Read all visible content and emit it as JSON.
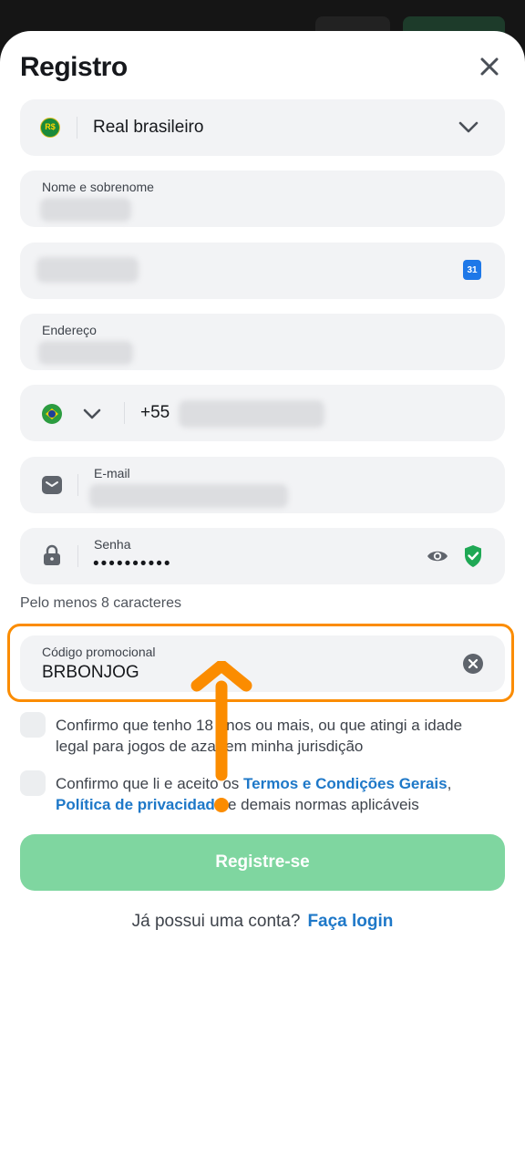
{
  "title": "Registro",
  "currency": {
    "symbol": "R$",
    "label": "Real brasileiro"
  },
  "name_field": {
    "label": "Nome e sobrenome"
  },
  "birthdate_field": {
    "calendar_day": "31"
  },
  "address_field": {
    "label": "Endereço"
  },
  "phone_field": {
    "country_code": "+55"
  },
  "email_field": {
    "label": "E-mail"
  },
  "password_field": {
    "label": "Senha",
    "value": "••••••••••"
  },
  "password_hint": "Pelo menos 8 caracteres",
  "promo_field": {
    "label": "Código promocional",
    "value": "BRBONJOG"
  },
  "age_checkbox": {
    "text": "Confirmo que tenho 18 anos ou mais, ou que atingi a idade legal para jogos de azar em minha jurisdição"
  },
  "terms_checkbox": {
    "prefix": "Confirmo que li e aceito os",
    "terms_link": "Termos e Condições Gerais",
    "comma": ",",
    "privacy_link": "Política de privacidade",
    "suffix": "e demais normas aplicáveis"
  },
  "submit_label": "Registre-se",
  "login": {
    "prompt": "Já possui uma conta?",
    "link": "Faça login"
  },
  "colors": {
    "accent_orange": "#fb8c00",
    "link_blue": "#1e78c8",
    "button_green": "#7fd6a0",
    "field_bg": "#f2f3f5"
  }
}
